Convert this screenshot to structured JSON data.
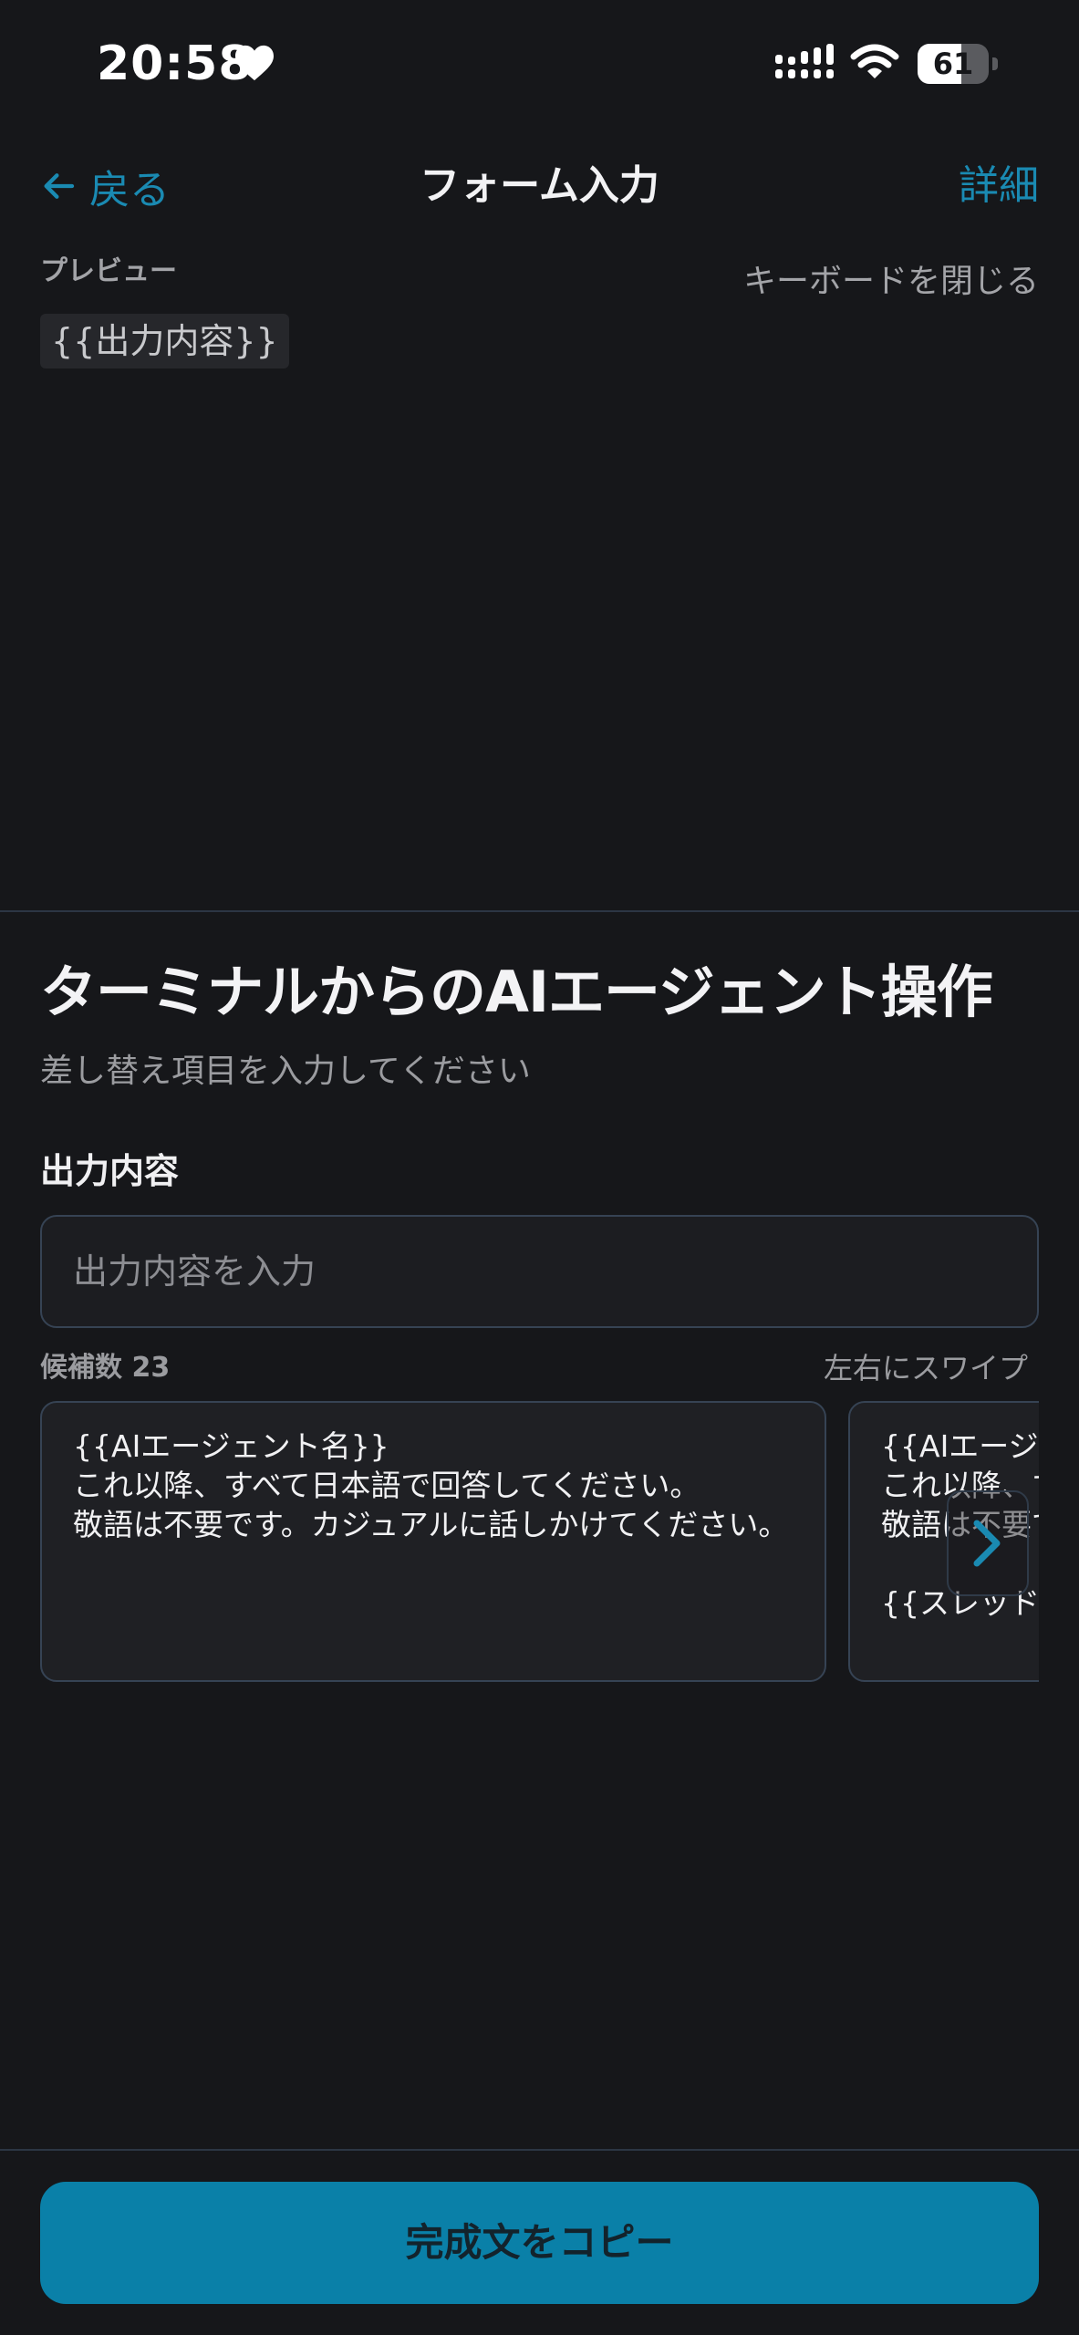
{
  "status_bar": {
    "time": "20:58",
    "battery_level": "61",
    "battery_fraction": 0.61,
    "icons": [
      "heart-icon",
      "signal-icon",
      "wifi-icon",
      "battery-icon"
    ]
  },
  "nav": {
    "back_label": "戻る",
    "title": "フォーム入力",
    "detail_label": "詳細"
  },
  "preview": {
    "label": "プレビュー",
    "close_keyboard_label": "キーボードを閉じる",
    "content": "{{出力内容}}"
  },
  "form": {
    "title": "ターミナルからのAIエージェント操作",
    "subtitle": "差し替え項目を入力してください",
    "field": {
      "label": "出力内容",
      "value": "",
      "placeholder": "出力内容を入力"
    }
  },
  "candidates": {
    "count_label": "候補数 23",
    "swipe_hint": "左右にスワイプ",
    "cards": [
      {
        "lines": [
          "{{AIエージェント名}}",
          "これ以降、すべて日本語で回答してください。",
          "敬語は不要です。カジュアルに話しかけてください。"
        ]
      },
      {
        "lines": [
          "{{AIエージェント名}}",
          "これ以降、すべて日本語で回答してください。",
          "敬語は不要です。カジュアルに話しかけてください。",
          "",
          "{{スレッド名}}"
        ]
      }
    ]
  },
  "footer": {
    "copy_button_label": "完成文をコピー"
  },
  "colors": {
    "background": "#16171a",
    "accent": "#1a8ab2",
    "button": "#0a80a8",
    "border": "#364354"
  }
}
